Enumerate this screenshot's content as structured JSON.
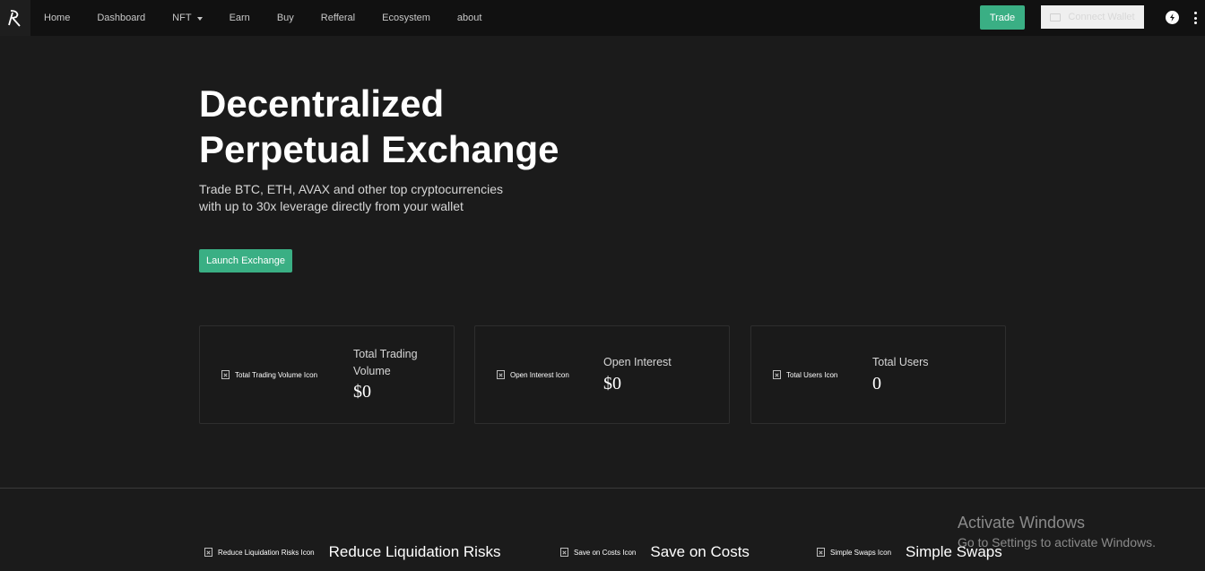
{
  "nav": {
    "items": [
      {
        "label": "Home"
      },
      {
        "label": "Dashboard"
      },
      {
        "label": "NFT"
      },
      {
        "label": "Earn"
      },
      {
        "label": "Buy"
      },
      {
        "label": "Refferal"
      },
      {
        "label": "Ecosystem"
      },
      {
        "label": "about"
      }
    ],
    "trade_label": "Trade",
    "connect_wallet_label": "Connect Wallet",
    "icons": {
      "logo": "logo-icon",
      "theme": "theme-toggle-icon",
      "more": "more-vertical-icon",
      "wallet": "wallet-icon",
      "nft_caret": "caret-down-icon"
    }
  },
  "hero": {
    "title_line1": "Decentralized",
    "title_line2": "Perpetual Exchange",
    "subtitle": "Trade BTC, ETH, AVAX and other top cryptocurrencies with up to 30x leverage directly from your wallet",
    "launch_label": "Launch Exchange"
  },
  "stats": [
    {
      "icon_alt": "Total Trading Volume Icon",
      "label": "Total Trading Volume",
      "value": "$0"
    },
    {
      "icon_alt": "Open Interest Icon",
      "label": "Open Interest",
      "value": "$0"
    },
    {
      "icon_alt": "Total Users Icon",
      "label": "Total Users",
      "value": "0"
    }
  ],
  "features": [
    {
      "icon_alt": "Reduce Liquidation Risks Icon",
      "title": "Reduce Liquidation Risks"
    },
    {
      "icon_alt": "Save on Costs Icon",
      "title": "Save on Costs"
    },
    {
      "icon_alt": "Simple Swaps Icon",
      "title": "Simple Swaps"
    }
  ],
  "watermark": {
    "title": "Activate Windows",
    "subtitle": "Go to Settings to activate Windows."
  },
  "colors": {
    "background": "#1b1b1b",
    "navbar": "#111111",
    "accent_green": "#3aaf84",
    "card_border": "#2e2e2e"
  }
}
